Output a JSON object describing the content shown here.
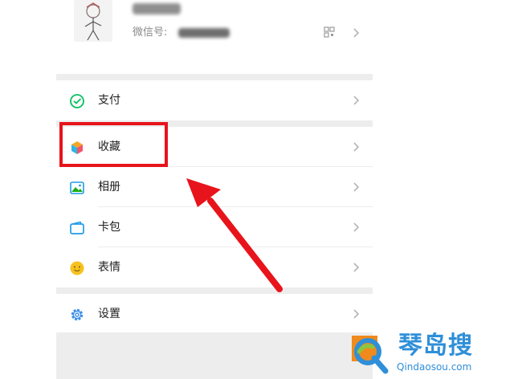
{
  "profile": {
    "wechat_id_label": "微信号:",
    "nickname_hidden": true,
    "wechat_id_hidden": true
  },
  "menu": {
    "items": [
      {
        "label": "支付",
        "icon": "pay-icon",
        "color": "#07c160"
      },
      {
        "label": "收藏",
        "icon": "favorites-cube-icon",
        "color": "#f5a623"
      },
      {
        "label": "相册",
        "icon": "album-icon",
        "color": "#1aad19"
      },
      {
        "label": "卡包",
        "icon": "card-wallet-icon",
        "color": "#1f9bea"
      },
      {
        "label": "表情",
        "icon": "sticker-smile-icon",
        "color": "#f7c21e"
      },
      {
        "label": "设置",
        "icon": "settings-gear-icon",
        "color": "#3a8ee6"
      }
    ]
  },
  "annotation": {
    "highlight_target": "收藏",
    "highlight_color": "#e8141b",
    "arrow_color": "#e8141b"
  },
  "watermark": {
    "title": "琴岛搜",
    "url": "Qindaosou.com",
    "color": "#2f8fd8"
  }
}
